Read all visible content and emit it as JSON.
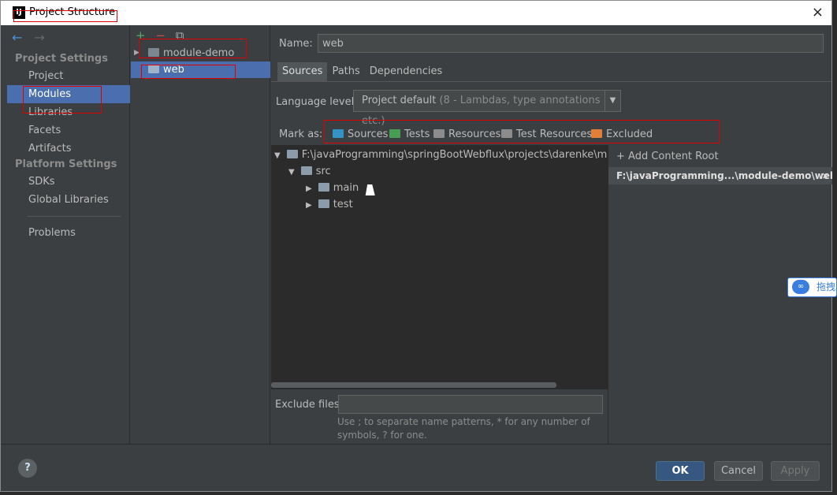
{
  "window": {
    "title": "Project Structure",
    "logo": "IJ",
    "close": "×"
  },
  "nav": {
    "back_icon": "←",
    "forward_icon": "→"
  },
  "left": {
    "project_settings_header": "Project Settings",
    "project_settings_items": [
      "Project",
      "Modules",
      "Libraries",
      "Facets",
      "Artifacts"
    ],
    "platform_settings_header": "Platform Settings",
    "platform_settings_items": [
      "SDKs",
      "Global Libraries"
    ],
    "problems": "Problems",
    "selected": "Modules"
  },
  "modules": {
    "toolbar": {
      "add": "+",
      "remove": "−",
      "copy": "⧉"
    },
    "items": [
      {
        "label": "module-demo",
        "expander": "▶"
      },
      {
        "label": "web"
      }
    ]
  },
  "name": {
    "label": "Name:",
    "value": "web"
  },
  "tabs": [
    "Sources",
    "Paths",
    "Dependencies"
  ],
  "language": {
    "label": "Language level:",
    "value": "Project default",
    "detail": "(8 - Lambdas, type annotations etc.)"
  },
  "mark_as": {
    "label": "Mark as:",
    "items": [
      {
        "label": "Sources",
        "color": "#3592c4"
      },
      {
        "label": "Tests",
        "color": "#499c54"
      },
      {
        "label": "Resources",
        "color": "#8c8c8c"
      },
      {
        "label": "Test Resources",
        "color": "#8c8c8c"
      },
      {
        "label": "Excluded",
        "color": "#e07e3a"
      }
    ]
  },
  "tree": {
    "root": "F:\\javaProgramming\\springBootWebflux\\projects\\darenke\\module-",
    "src": "src",
    "main": "main",
    "test": "test"
  },
  "exclude": {
    "label": "Exclude files:",
    "value": "",
    "hint": "Use ; to separate name patterns, * for any number of symbols, ? for one."
  },
  "content_root": {
    "add": "+ Add Content Root",
    "path": "F:\\javaProgramming...\\module-demo\\web",
    "remove": "×"
  },
  "buttons": {
    "help": "?",
    "ok": "OK",
    "cancel": "Cancel",
    "apply": "Apply"
  },
  "side_badge": {
    "icon": "∞",
    "text": "拖拽"
  },
  "colors": {
    "selection": "#4b6eaf",
    "panel": "#3c3f41",
    "tree_bg": "#2b2b2b",
    "annotation_red": "#e00000"
  }
}
